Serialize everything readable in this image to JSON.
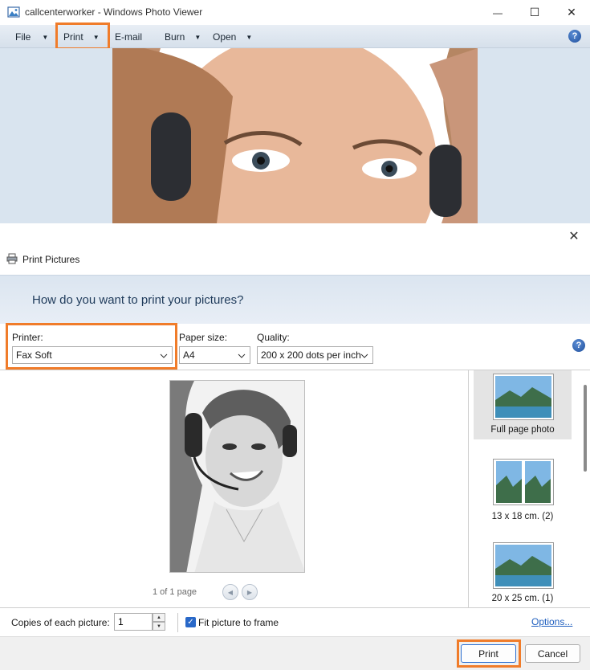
{
  "window": {
    "title": "callcenterworker - Windows Photo Viewer",
    "minimize": "—",
    "maximize": "☐",
    "close": "✕"
  },
  "menubar": {
    "items": [
      {
        "label": "File",
        "caret": "▼"
      },
      {
        "label": "Print",
        "caret": "▼"
      },
      {
        "label": "E-mail"
      },
      {
        "label": "Burn",
        "caret": "▼"
      },
      {
        "label": "Open",
        "caret": "▼"
      }
    ],
    "help": "?"
  },
  "dialog": {
    "title": "Print Pictures",
    "close": "✕",
    "question": "How do you want to print your pictures?",
    "printer": {
      "label": "Printer:",
      "value": "Fax Soft"
    },
    "paper_size": {
      "label": "Paper size:",
      "value": "A4"
    },
    "quality": {
      "label": "Quality:",
      "value": "200 x 200 dots per inch"
    },
    "help": "?",
    "page_counter": "1 of 1 page",
    "nav_prev": "◀",
    "nav_next": "▶",
    "layouts": [
      {
        "label": "Full page photo",
        "selected": true
      },
      {
        "label": "13 x 18 cm. (2)",
        "selected": false
      },
      {
        "label": "20 x 25 cm. (1)",
        "selected": false
      }
    ],
    "copies": {
      "label": "Copies of each picture:",
      "value": "1",
      "up": "▲",
      "down": "▼"
    },
    "fit": {
      "label": "Fit picture to frame",
      "checked": true,
      "check": "✓"
    },
    "options_link": "Options...",
    "buttons": {
      "print": "Print",
      "cancel": "Cancel"
    }
  },
  "highlight_color": "#f07c2a",
  "icons": [
    "photo-viewer-app-icon",
    "help-icon",
    "printer-icon",
    "close-icon",
    "chevron-down-icon",
    "arrow-left-icon",
    "arrow-right-icon",
    "checkmark-icon"
  ]
}
